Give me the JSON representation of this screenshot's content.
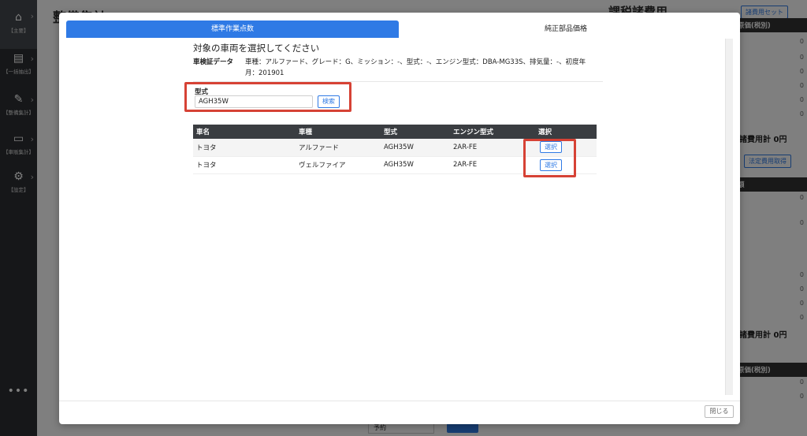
{
  "sidebar": {
    "items": [
      {
        "label": "【主要】",
        "icon": "home-icon",
        "glyph": "⌂"
      },
      {
        "label": "【一括抽出】",
        "icon": "file-export-icon",
        "glyph": "▤"
      },
      {
        "label": "【整備集計】",
        "icon": "wrench-icon",
        "glyph": "✎"
      },
      {
        "label": "【車販集計】",
        "icon": "car-icon",
        "glyph": "▭"
      },
      {
        "label": "【設定】",
        "icon": "gear-icon",
        "glyph": "⚙"
      }
    ],
    "more": "•••"
  },
  "background": {
    "page_title": "整備集計",
    "right_title": "課税諸費用",
    "expense_set_button": "諸費用セット",
    "cost_header_1": "原価(税別)",
    "total_1": "諸費用計 0円",
    "legal_fee_button": "法定費用取得",
    "amount_header": "額",
    "total_2": "諸費用計 0円",
    "cost_header_2": "原価(税別)",
    "zero": "0",
    "select_value": "予約"
  },
  "modal": {
    "tabs": [
      {
        "label": "標準作業点数"
      },
      {
        "label": "純正部品価格"
      }
    ],
    "section_title": "対象の車両を選択してください",
    "shaken_label": "車検証データ",
    "shaken_value": "車種：アルファード、グレード：G、ミッション：-、型式：-、エンジン型式：DBA-MG33S、排気量：-、初度年月：201901",
    "form_label": "型式",
    "search_value": "AGH35W",
    "search_button": "検索",
    "table": {
      "headers": [
        "車名",
        "車種",
        "型式",
        "エンジン型式",
        "選択"
      ],
      "rows": [
        {
          "maker": "トヨタ",
          "model": "アルファード",
          "type": "AGH35W",
          "engine": "2AR-FE",
          "select": "選択"
        },
        {
          "maker": "トヨタ",
          "model": "ヴェルファイア",
          "type": "AGH35W",
          "engine": "2AR-FE",
          "select": "選択"
        }
      ]
    },
    "close_button": "閉じる"
  },
  "colors": {
    "accent": "#2f7ae5",
    "highlight": "#d64235",
    "sidebar": "#2c2f33"
  }
}
